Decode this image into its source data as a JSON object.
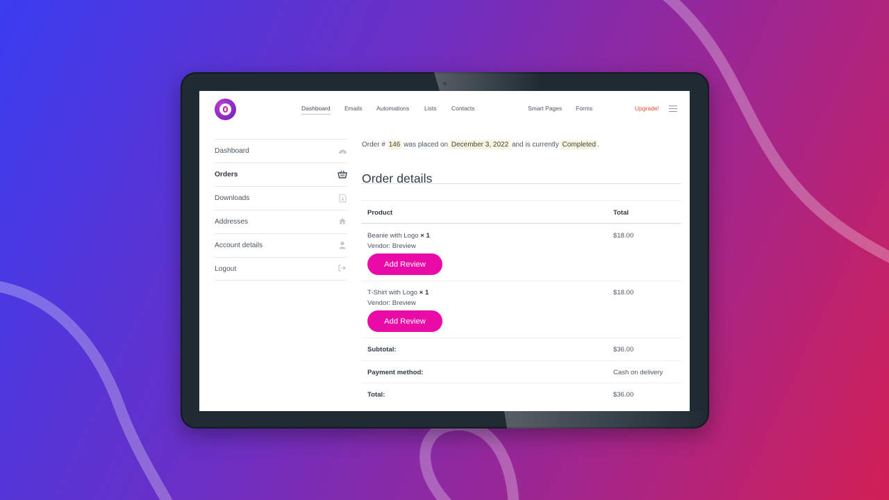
{
  "nav": {
    "items": [
      {
        "label": "Dashboard",
        "active": true
      },
      {
        "label": "Emails"
      },
      {
        "label": "Automations"
      },
      {
        "label": "Lists"
      },
      {
        "label": "Contacts"
      },
      {
        "label": "Smart Pages"
      },
      {
        "label": "Forms"
      }
    ],
    "upgrade": "Upgrade!"
  },
  "sidebar": {
    "items": [
      {
        "label": "Dashboard",
        "icon": "dashboard-icon"
      },
      {
        "label": "Orders",
        "icon": "basket-icon",
        "active": true
      },
      {
        "label": "Downloads",
        "icon": "file-download-icon"
      },
      {
        "label": "Addresses",
        "icon": "home-icon"
      },
      {
        "label": "Account details",
        "icon": "user-icon"
      },
      {
        "label": "Logout",
        "icon": "logout-icon"
      }
    ]
  },
  "order": {
    "notice": {
      "prefix": "Order #",
      "number": "146",
      "mid1": "was placed on",
      "date": "December 3, 2022",
      "mid2": "and is currently",
      "status": "Completed",
      "suffix": "."
    },
    "title": "Order details",
    "table": {
      "header": {
        "product": "Product",
        "total": "Total"
      },
      "items": [
        {
          "name": "Beanie with Logo",
          "qty": "× 1",
          "vendor": "Vendor: Breview",
          "total": "$18.00",
          "button": "Add Review"
        },
        {
          "name": "T-Shirt with Logo",
          "qty": "× 1",
          "vendor": "Vendor: Breview",
          "total": "$18.00",
          "button": "Add Review"
        }
      ],
      "summary": [
        {
          "label": "Subtotal:",
          "value": "$36.00"
        },
        {
          "label": "Payment method:",
          "value": "Cash on delivery"
        },
        {
          "label": "Total:",
          "value": "$36.00"
        }
      ]
    }
  },
  "colors": {
    "accent": "#ea0aa6",
    "upgrade": "#ee4b2b",
    "highlight": "#fbf5dc",
    "device": "#1f2a33"
  }
}
